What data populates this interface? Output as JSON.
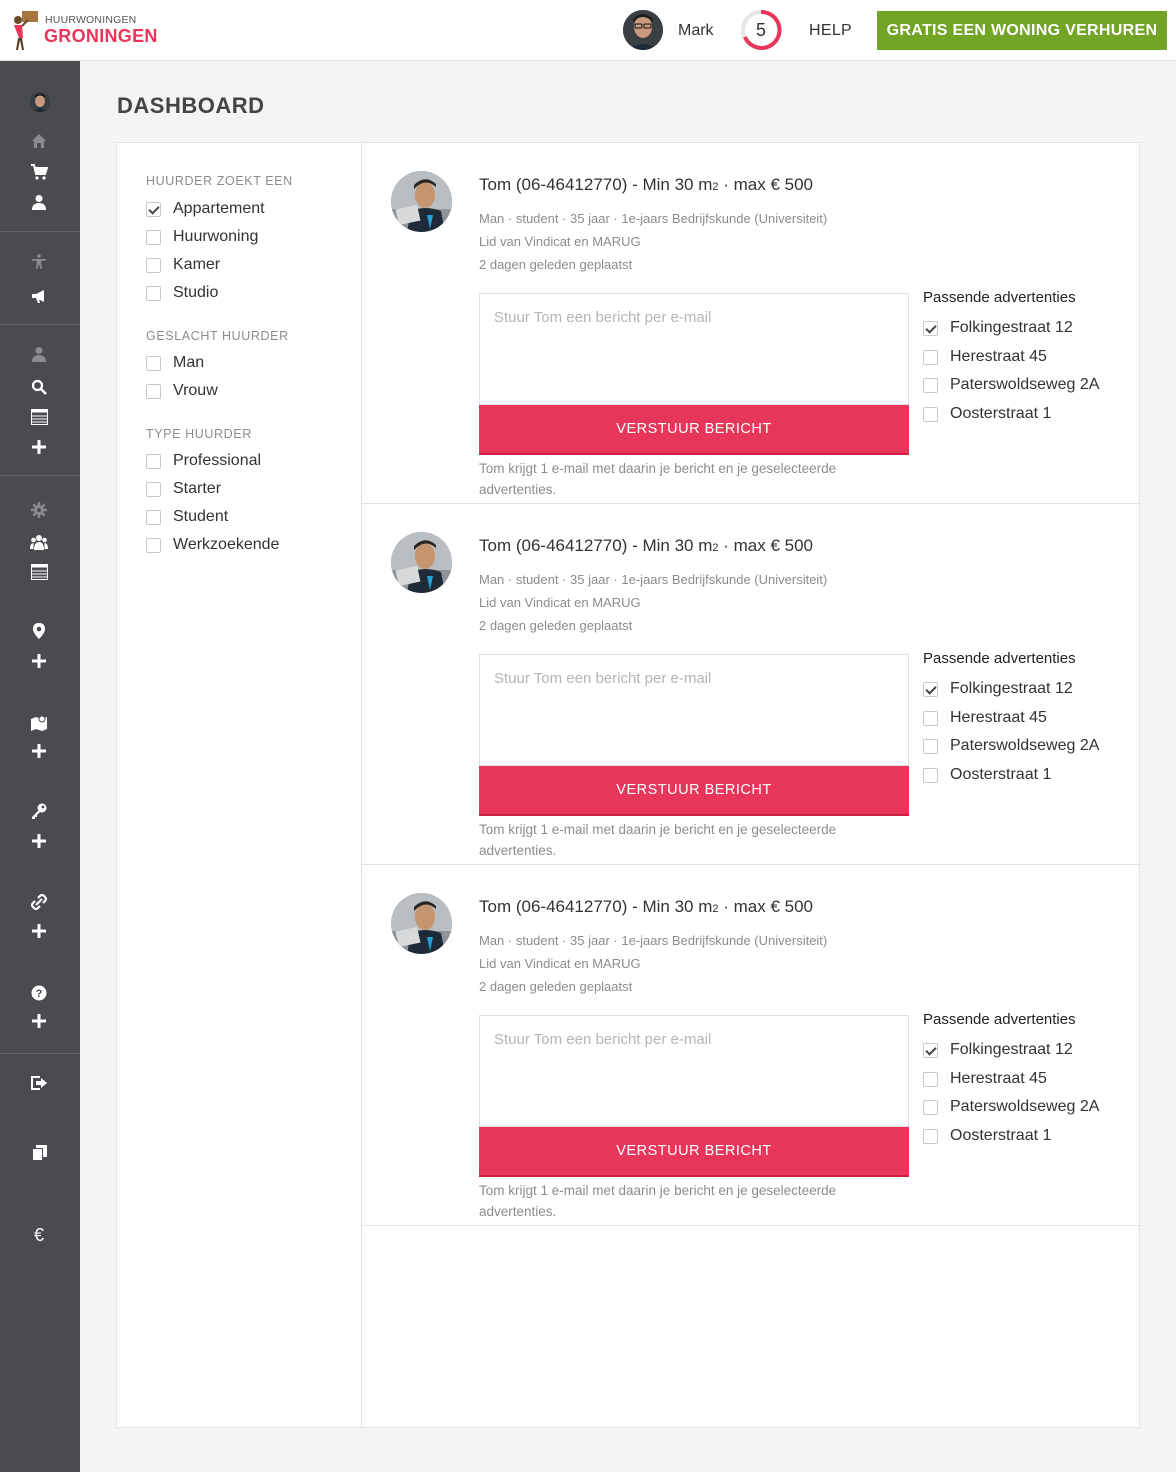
{
  "header": {
    "logo_small": "HUURWONINGEN",
    "logo_big": "GRONINGEN",
    "user_name": "Mark",
    "notification_count": "5",
    "help_label": "HELP",
    "cta_label": "GRATIS EEN WONING VERHUREN"
  },
  "colors": {
    "brand_red": "#e8365a",
    "cta_green": "#72a526",
    "sidebar": "#4a4b50"
  },
  "sidebar": {
    "icons": [
      "avatar",
      "home-icon",
      "cart-icon",
      "user-icon",
      "accessibility-icon",
      "megaphone-icon",
      "user-icon",
      "search-icon",
      "list-icon",
      "plus-icon",
      "gear-icon",
      "group-icon",
      "list-icon",
      "map-pin-icon",
      "plus-icon",
      "map-icon",
      "plus-icon",
      "key-icon",
      "plus-icon",
      "link-icon",
      "plus-icon",
      "question-icon",
      "plus-icon",
      "logout-icon",
      "copy-icon",
      "euro-icon"
    ],
    "euro_glyph": "€"
  },
  "page": {
    "title": "DASHBOARD"
  },
  "filters": {
    "groups": [
      {
        "heading": "HUURDER ZOEKT EEN",
        "options": [
          {
            "label": "Appartement",
            "checked": true
          },
          {
            "label": "Huurwoning",
            "checked": false
          },
          {
            "label": "Kamer",
            "checked": false
          },
          {
            "label": "Studio",
            "checked": false
          }
        ]
      },
      {
        "heading": "GESLACHT HUURDER",
        "options": [
          {
            "label": "Man",
            "checked": false
          },
          {
            "label": "Vrouw",
            "checked": false
          }
        ]
      },
      {
        "heading": "TYPE HUURDER",
        "options": [
          {
            "label": "Professional",
            "checked": false
          },
          {
            "label": "Starter",
            "checked": false
          },
          {
            "label": "Student",
            "checked": false
          },
          {
            "label": "Werkzoekende",
            "checked": false
          }
        ]
      }
    ]
  },
  "cards": [
    {
      "title_main": "Tom (06-46412770) - Min 30 m",
      "title_sup": "2",
      "title_tail": " · max € 500",
      "meta1": "Man · student · 35 jaar · 1e-jaars Bedrijfskunde (Universiteit)",
      "meta2": "Lid van Vindicat en MARUG",
      "meta3": "2 dagen geleden geplaatst",
      "message_placeholder": "Stuur Tom een bericht per e-mail",
      "send_label": "VERSTUUR BERICHT",
      "note": "Tom krijgt 1 e-mail met daarin je bericht en je geselecteerde advertenties.",
      "ads_heading": "Passende advertenties",
      "ads": [
        {
          "label": "Folkingestraat 12",
          "checked": true
        },
        {
          "label": "Herestraat 45",
          "checked": false
        },
        {
          "label": "Paterswoldseweg 2A",
          "checked": false
        },
        {
          "label": "Oosterstraat 1",
          "checked": false
        }
      ]
    },
    {
      "title_main": "Tom (06-46412770) - Min 30 m",
      "title_sup": "2",
      "title_tail": " · max € 500",
      "meta1": "Man · student · 35 jaar · 1e-jaars Bedrijfskunde (Universiteit)",
      "meta2": "Lid van Vindicat en MARUG",
      "meta3": "2 dagen geleden geplaatst",
      "message_placeholder": "Stuur Tom een bericht per e-mail",
      "send_label": "VERSTUUR BERICHT",
      "note": "Tom krijgt 1 e-mail met daarin je bericht en je geselecteerde advertenties.",
      "ads_heading": "Passende advertenties",
      "ads": [
        {
          "label": "Folkingestraat 12",
          "checked": true
        },
        {
          "label": "Herestraat 45",
          "checked": false
        },
        {
          "label": "Paterswoldseweg 2A",
          "checked": false
        },
        {
          "label": "Oosterstraat 1",
          "checked": false
        }
      ]
    },
    {
      "title_main": "Tom (06-46412770) - Min 30 m",
      "title_sup": "2",
      "title_tail": " · max € 500",
      "meta1": "Man · student · 35 jaar · 1e-jaars Bedrijfskunde (Universiteit)",
      "meta2": "Lid van Vindicat en MARUG",
      "meta3": "2 dagen geleden geplaatst",
      "message_placeholder": "Stuur Tom een bericht per e-mail",
      "send_label": "VERSTUUR BERICHT",
      "note": "Tom krijgt 1 e-mail met daarin je bericht en je geselecteerde advertenties.",
      "ads_heading": "Passende advertenties",
      "ads": [
        {
          "label": "Folkingestraat 12",
          "checked": true
        },
        {
          "label": "Herestraat 45",
          "checked": false
        },
        {
          "label": "Paterswoldseweg 2A",
          "checked": false
        },
        {
          "label": "Oosterstraat 1",
          "checked": false
        }
      ]
    }
  ]
}
